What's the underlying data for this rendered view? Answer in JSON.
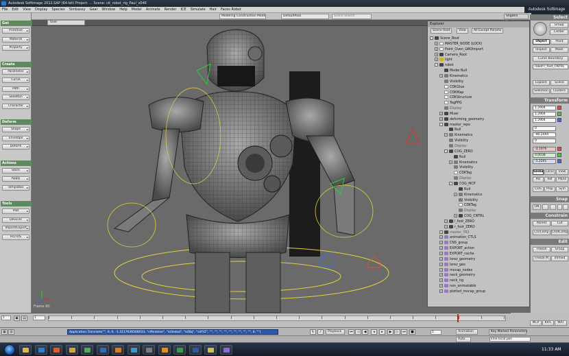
{
  "app": {
    "title": "Autodesk Softimage 2012.SAP (64-bit)   Project: ...   Scene: cit_robot_rig_Paul_v046",
    "brand": "Autodesk Softimage"
  },
  "menu": [
    "File",
    "Edit",
    "View",
    "Display",
    "Species",
    "Simbassy",
    "Gear",
    "Window",
    "Help",
    "Model",
    "Animate",
    "Render",
    "ICE",
    "Simulate",
    "Hair",
    "Faces Robot"
  ],
  "toolbar": {
    "construction_mode": "Modeling Construction Mode",
    "pass": "DefaultPass",
    "search_placeholder": "Scene Search",
    "layer": "Shgde4"
  },
  "left_panel": {
    "mode": "Animate",
    "sections": [
      {
        "title": "Get",
        "buttons": [
          "Primitive",
          "Material",
          "Property"
        ]
      },
      {
        "title": "Create",
        "buttons": [
          "Parameter",
          "Curve",
          "Path",
          "Skeleton",
          "Character"
        ]
      },
      {
        "title": "Deform",
        "buttons": [
          "Shape",
          "Envelope",
          "Deform"
        ]
      },
      {
        "title": "Actions",
        "buttons": [
          "Store",
          "Apply",
          "Templates"
        ]
      },
      {
        "title": "Tools",
        "buttons": [
          "Plot",
          "Devices",
          "Import/Export",
          "HOTOS"
        ]
      }
    ]
  },
  "viewport": {
    "view_name": "User",
    "mode": "Shaded",
    "frame_label": "Frame 90"
  },
  "explorer": {
    "title": "Explorer",
    "tabs": [
      "Scene Root",
      "View",
      "All Except Params"
    ],
    "tree": [
      {
        "label": "Scene_Root",
        "level": 0,
        "icon": "k",
        "pm": "-"
      },
      {
        "label": "MASTER_NODE (LOCK)",
        "level": 1,
        "icon": "w",
        "pm": "+"
      },
      {
        "label": "Point_Oven_LWOImport",
        "level": 1,
        "icon": "w",
        "pm": "+"
      },
      {
        "label": "Camera_Root",
        "level": 1,
        "icon": "k",
        "pm": "+"
      },
      {
        "label": "light",
        "level": 1,
        "icon": "y",
        "pm": "+"
      },
      {
        "label": "robot",
        "level": 1,
        "icon": "k",
        "pm": "-"
      },
      {
        "label": "Model Null",
        "level": 2,
        "icon": "k",
        "pm": ""
      },
      {
        "label": "Kinematics",
        "level": 2,
        "icon": "g",
        "pm": "+"
      },
      {
        "label": "Visibility",
        "level": 2,
        "icon": "g",
        "pm": ""
      },
      {
        "label": "CDKGlue",
        "level": 2,
        "icon": "w",
        "pm": ""
      },
      {
        "label": "CDKMap",
        "level": 2,
        "icon": "w",
        "pm": ""
      },
      {
        "label": "CDKStructure",
        "level": 2,
        "icon": "w",
        "pm": ""
      },
      {
        "label": "TagPPG",
        "level": 2,
        "icon": "w",
        "pm": ""
      },
      {
        "label": "Display",
        "level": 2,
        "icon": "g",
        "pm": "",
        "dim": true
      },
      {
        "label": "Mixer",
        "level": 2,
        "icon": "k",
        "pm": "+"
      },
      {
        "label": "deforming_geometry",
        "level": 2,
        "icon": "k",
        "pm": "+"
      },
      {
        "label": "master_repo",
        "level": 2,
        "icon": "k",
        "pm": "-"
      },
      {
        "label": "Null",
        "level": 3,
        "icon": "k",
        "pm": ""
      },
      {
        "label": "Kinematics",
        "level": 3,
        "icon": "g",
        "pm": "+"
      },
      {
        "label": "Visibility",
        "level": 3,
        "icon": "g",
        "pm": ""
      },
      {
        "label": "Display",
        "level": 3,
        "icon": "g",
        "pm": "",
        "dim": true
      },
      {
        "label": "COG_ZERO",
        "level": 3,
        "icon": "k",
        "pm": "-"
      },
      {
        "label": "Null",
        "level": 4,
        "icon": "k",
        "pm": ""
      },
      {
        "label": "Kinematics",
        "level": 4,
        "icon": "g",
        "pm": "+"
      },
      {
        "label": "Visibility",
        "level": 4,
        "icon": "g",
        "pm": ""
      },
      {
        "label": "CDKTag",
        "level": 4,
        "icon": "w",
        "pm": ""
      },
      {
        "label": "Display",
        "level": 4,
        "icon": "g",
        "pm": "",
        "dim": true
      },
      {
        "label": "COG_MCP",
        "level": 4,
        "icon": "k",
        "pm": "-"
      },
      {
        "label": "Null",
        "level": 5,
        "icon": "k",
        "pm": ""
      },
      {
        "label": "Kinematics",
        "level": 5,
        "icon": "g",
        "pm": "+"
      },
      {
        "label": "Visibility",
        "level": 5,
        "icon": "g",
        "pm": ""
      },
      {
        "label": "CDKTag",
        "level": 5,
        "icon": "w",
        "pm": ""
      },
      {
        "label": "Display",
        "level": 5,
        "icon": "g",
        "pm": "",
        "dim": true
      },
      {
        "label": "COG_CNTRL",
        "level": 5,
        "icon": "k",
        "pm": "+"
      },
      {
        "label": "l_foot_ZERO",
        "level": 3,
        "icon": "k",
        "pm": "+"
      },
      {
        "label": "r_foot_ZERO",
        "level": 3,
        "icon": "k",
        "pm": "+"
      },
      {
        "label": "master_TRS",
        "level": 2,
        "icon": "k",
        "pm": "+",
        "dim": true
      },
      {
        "label": "animation_CTLS",
        "level": 2,
        "icon": "p",
        "pm": "+"
      },
      {
        "label": "CNS_group",
        "level": 2,
        "icon": "p",
        "pm": "+"
      },
      {
        "label": "EXPORT_action",
        "level": 2,
        "icon": "p",
        "pm": "+"
      },
      {
        "label": "EXPORT_cache",
        "level": 2,
        "icon": "p",
        "pm": "+"
      },
      {
        "label": "lorez_geometry",
        "level": 2,
        "icon": "p",
        "pm": "+"
      },
      {
        "label": "lorez_geo",
        "level": 2,
        "icon": "p",
        "pm": "+"
      },
      {
        "label": "mocap_nodes",
        "level": 2,
        "icon": "p",
        "pm": "+"
      },
      {
        "label": "neck_geometry",
        "level": 2,
        "icon": "p",
        "pm": "+"
      },
      {
        "label": "neck_rig",
        "level": 2,
        "icon": "p",
        "pm": "+"
      },
      {
        "label": "non_animatable",
        "level": 2,
        "icon": "p",
        "pm": "+"
      },
      {
        "label": "plotted_mocap_group",
        "level": 2,
        "icon": "p",
        "pm": "+"
      }
    ]
  },
  "right_panel": {
    "select_header": "Select",
    "group": "Group",
    "center": "Center",
    "object": "Object",
    "point": "Point",
    "inspect": "Inspect",
    "mixer": "Mixer",
    "curve_boundary": "Curve Boundary",
    "selection_name": "robot:r_foot_CNTRL",
    "explore": "Explore",
    "scene": "Scene",
    "selection": "Selection",
    "clusters": "Clusters",
    "transform_header": "Transform",
    "scale_vals": [
      "1.2904",
      "1.2904",
      "1.2904"
    ],
    "rot_vals": [
      "0",
      "-90.2494",
      "0"
    ],
    "pos_vals": [
      "-3.1076",
      "0.0038",
      "-1.2201"
    ],
    "global": "Global",
    "local": "Local",
    "view": "View",
    "par": "Par",
    "ref": "Ref",
    "plane": "Plane",
    "cog": "COG",
    "prop": "Prop",
    "sym": "Sym",
    "snap_header": "Snap",
    "on": "ON",
    "constrain_header": "Constrain",
    "parent": "Parent",
    "cut": "Cut",
    "cnscomp": "CnsComp",
    "chldcomp": "ChldComp",
    "edit_header": "Edit",
    "freeze": "Freeze",
    "group2": "Group",
    "freeze_m": "Freeze M",
    "immed": "Immed",
    "mcp": "MCP",
    "kp_l": "KP/L",
    "mat": "MAT"
  },
  "timeline": {
    "start": "1",
    "end": "100",
    "current": "90",
    "end_field": "100",
    "ticks": [
      "1",
      "5",
      "10",
      "15",
      "20",
      "25",
      "30",
      "35",
      "40",
      "45",
      "50",
      "55",
      "60",
      "65",
      "70",
      "75",
      "80",
      "85",
      "90",
      "95",
      "100"
    ]
  },
  "command": {
    "script_line": "Application.Translate(\"\", 0, 0, -1.3117636568033, \"siRelative\", \"siGlobal\", \"siObj\", \"siXYZ\", \"\", \"\", \"\", \"\", \"\", \"\", \"\", \"\", \"\", 0, \"\")",
    "playback": "Playback",
    "frame_field": "1",
    "animation": "Animation",
    "auto": "Auto",
    "key_marked": "Key Marked Parameters",
    "kine_field": "kine.local.pos"
  },
  "taskbar": {
    "clock": "11:33 AM",
    "apps": [
      "explorer",
      "ie",
      "media",
      "folder",
      "chrome",
      "ps",
      "ai",
      "softimage",
      "maya",
      "vlc",
      "excel",
      "word",
      "notes",
      "misc"
    ]
  }
}
